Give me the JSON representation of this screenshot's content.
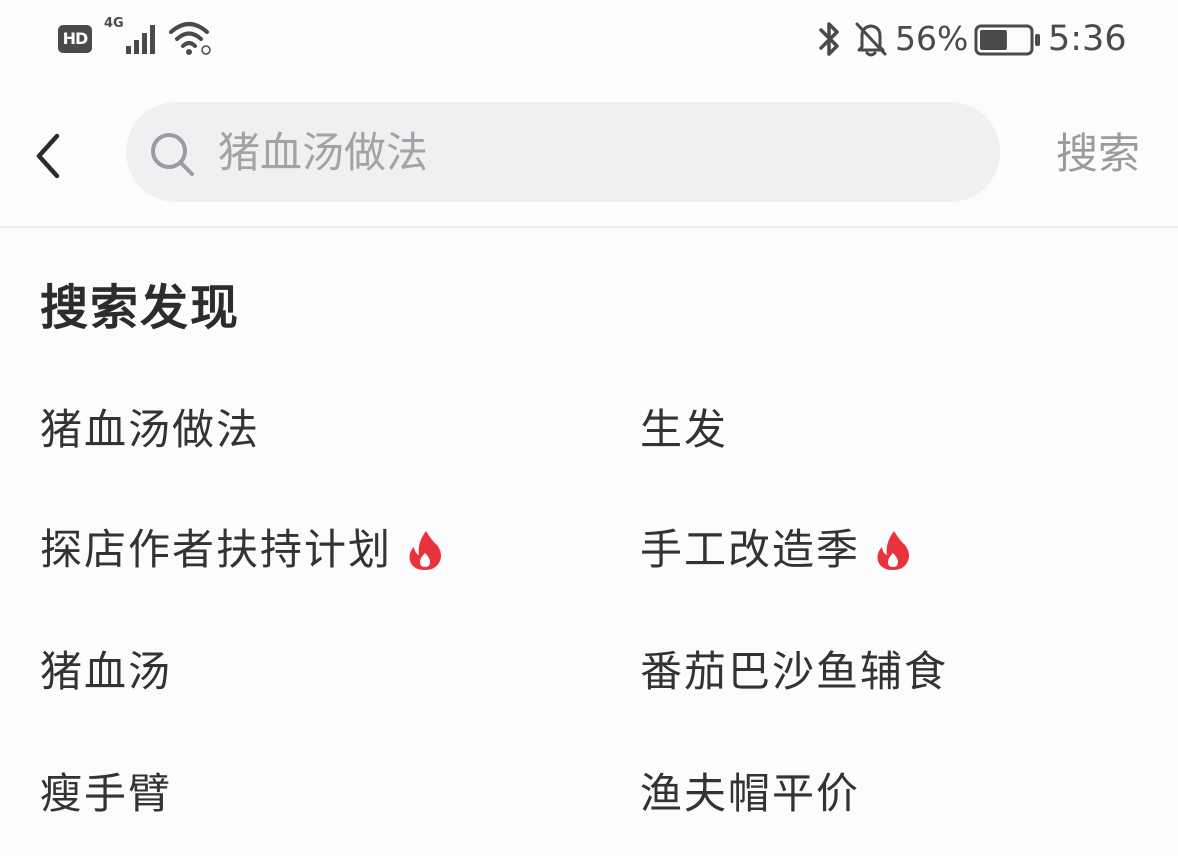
{
  "status_bar": {
    "hd_label": "HD",
    "network_label": "4G",
    "battery_percent": "56%",
    "battery_level": 0.56,
    "time": "5:36",
    "icons": [
      "signal-icon",
      "wifi-icon",
      "bluetooth-icon",
      "bell-off-icon",
      "battery-icon"
    ]
  },
  "header": {
    "back_icon": "chevron-left-icon",
    "search": {
      "icon": "search-icon",
      "placeholder": "猪血汤做法",
      "value": ""
    },
    "search_button_label": "搜索"
  },
  "discovery": {
    "title": "搜索发现",
    "accent_color": "#e8323c",
    "items": [
      {
        "label": "猪血汤做法",
        "hot": false
      },
      {
        "label": "生发",
        "hot": false
      },
      {
        "label": "探店作者扶持计划",
        "hot": true
      },
      {
        "label": "手工改造季",
        "hot": true
      },
      {
        "label": "猪血汤",
        "hot": false
      },
      {
        "label": "番茄巴沙鱼辅食",
        "hot": false
      },
      {
        "label": "瘦手臂",
        "hot": false
      },
      {
        "label": "渔夫帽平价",
        "hot": false
      }
    ]
  }
}
